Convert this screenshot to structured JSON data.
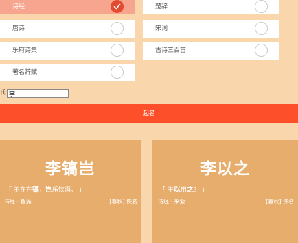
{
  "options": [
    {
      "label": "诗经",
      "selected": true
    },
    {
      "label": "楚辞",
      "selected": false
    },
    {
      "label": "唐诗",
      "selected": false
    },
    {
      "label": "宋词",
      "selected": false
    },
    {
      "label": "乐府诗集",
      "selected": false
    },
    {
      "label": "古诗三百首",
      "selected": false
    },
    {
      "label": "著名辞赋",
      "selected": false
    }
  ],
  "surname": {
    "label": "姓氏",
    "value": "李"
  },
  "generate_button": "起名",
  "cards": [
    {
      "name": "李镐岂",
      "verse_open": "「 王在在",
      "verse_hl1": "镐",
      "verse_mid": "，",
      "verse_hl2": "岂",
      "verse_close": "乐饮酒。 」",
      "source": "诗经 · 鱼藻",
      "author": "[春秋] 佚名"
    },
    {
      "name": "李以之",
      "verse_open": "「 于",
      "verse_hl1": "以",
      "verse_mid": "用",
      "verse_hl2": "之",
      "verse_close": "？ 」",
      "source": "诗经 · 采蘩",
      "author": "[春秋] 佚名"
    }
  ],
  "colors": {
    "background": "#f9d6ac",
    "button": "#fd4f2a",
    "card": "#e7ad6d",
    "selected_option": "#f7a58e",
    "check": "#e24b2f"
  }
}
